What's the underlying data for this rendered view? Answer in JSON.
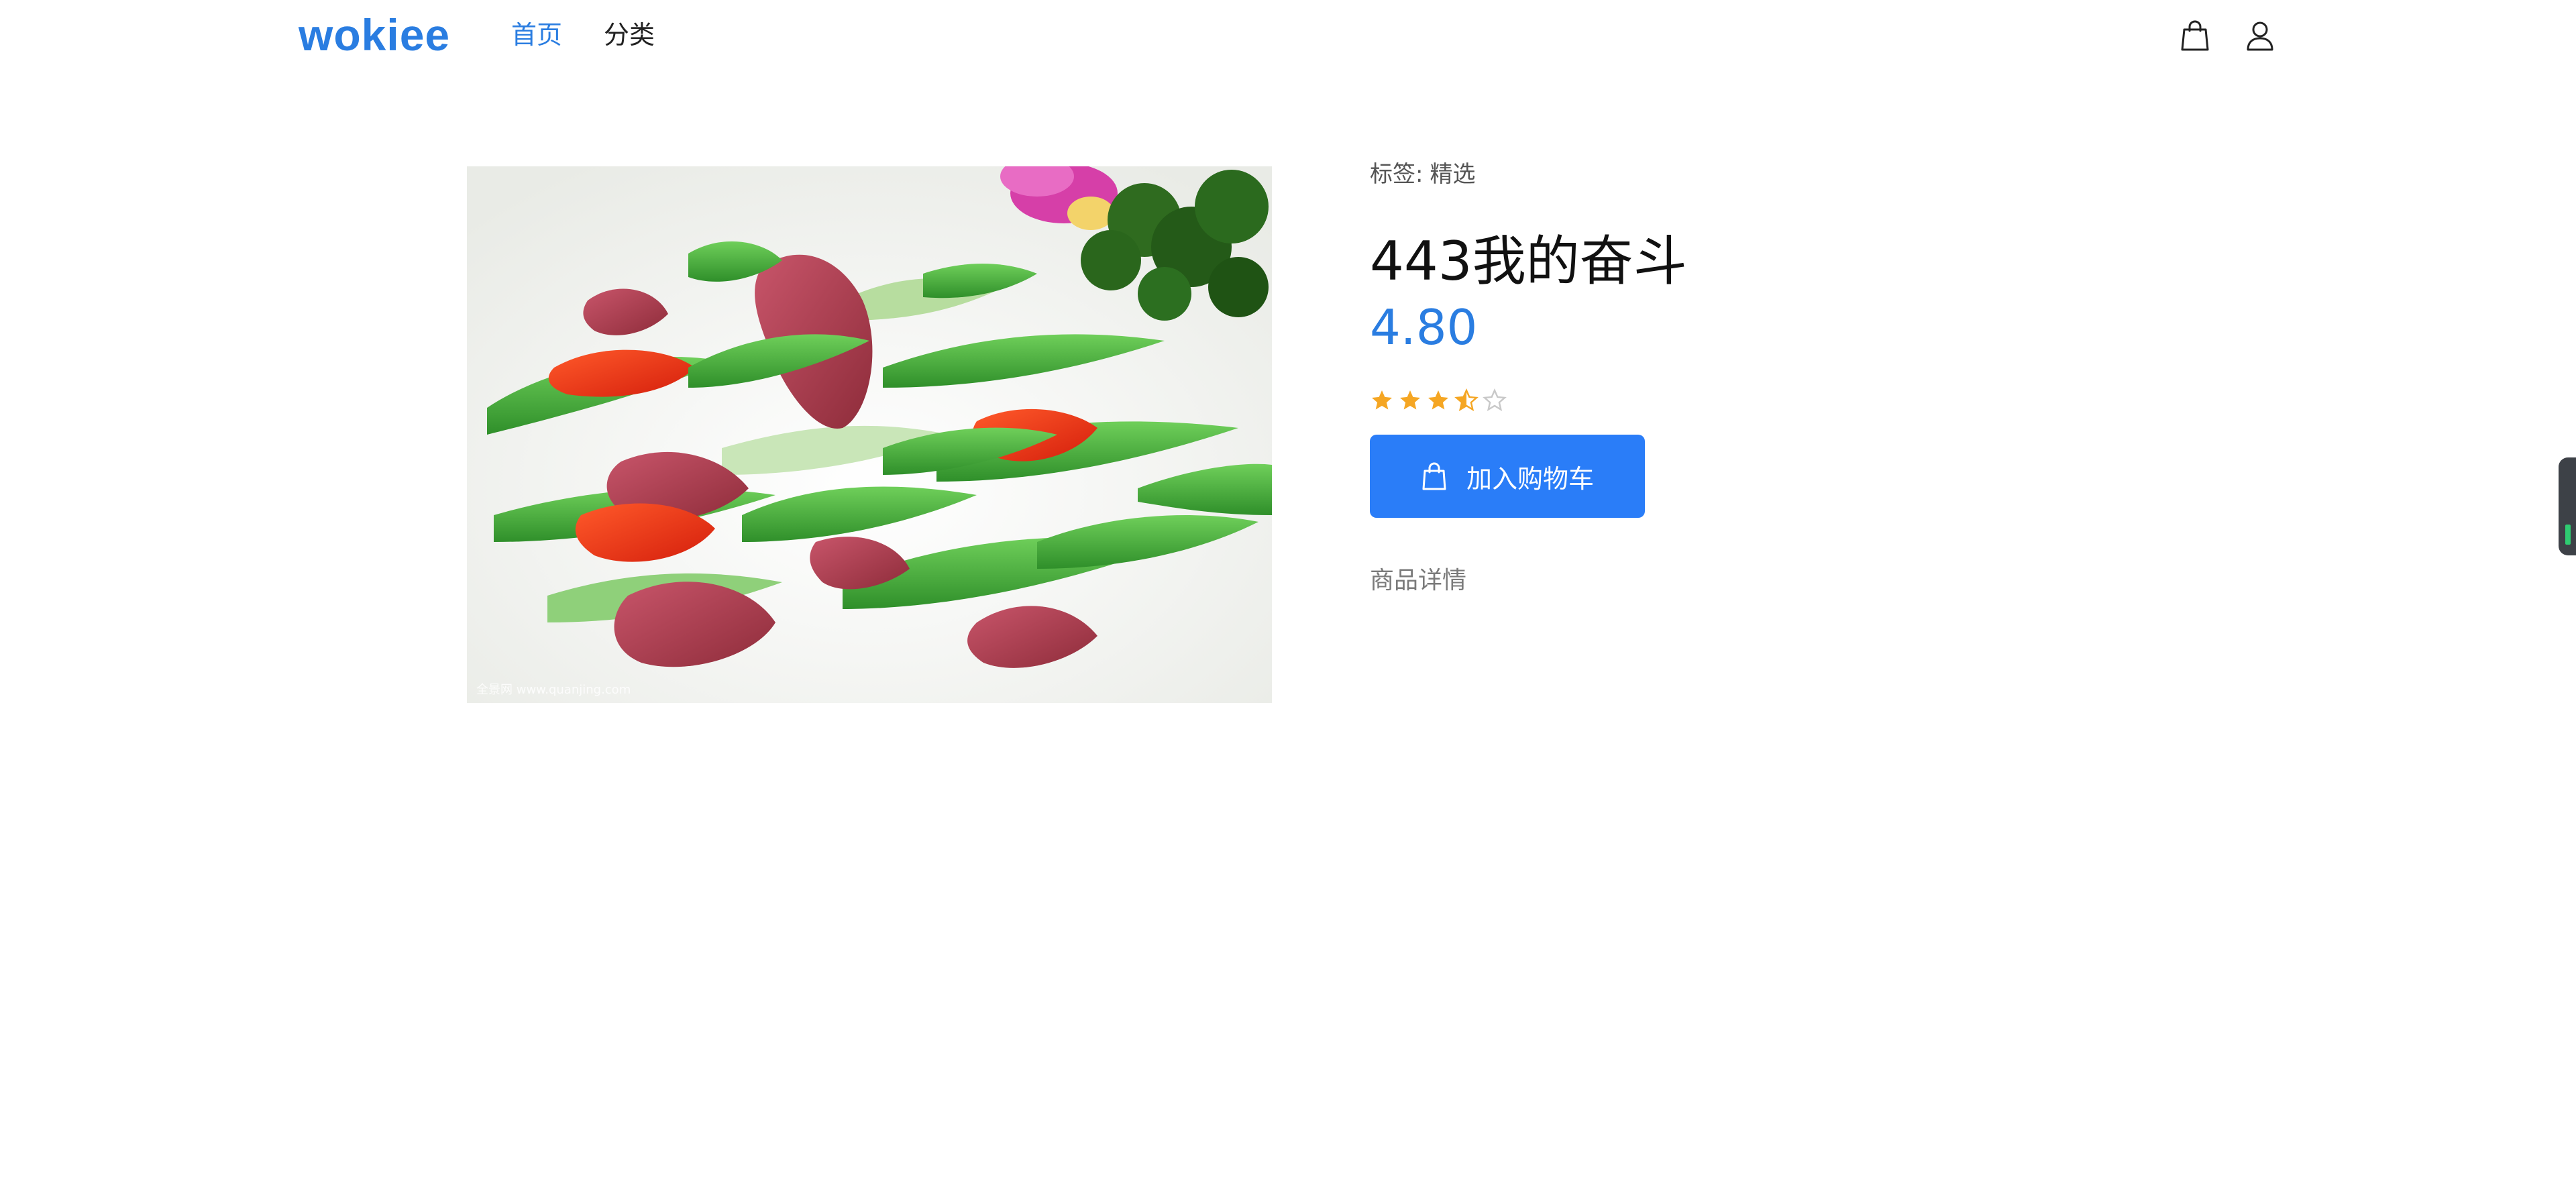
{
  "header": {
    "logo": "wokiee",
    "nav": [
      {
        "label": "首页",
        "active": true
      },
      {
        "label": "分类",
        "active": false
      }
    ],
    "cart_icon": "shopping-bag-icon",
    "user_icon": "user-icon"
  },
  "product": {
    "tag_label": "标签:",
    "tag_value": "精选",
    "title": "443我的奋斗",
    "price": "4.80",
    "rating": 3.5,
    "rating_max": 5,
    "add_to_cart_label": "加入购物车",
    "details_label": "商品详情",
    "image_watermark": "全景网 www.quanjing.com"
  },
  "colors": {
    "accent": "#2a7de1",
    "button": "#2a7df8",
    "star": "#f5a623",
    "star_empty": "#c8c8c8"
  }
}
